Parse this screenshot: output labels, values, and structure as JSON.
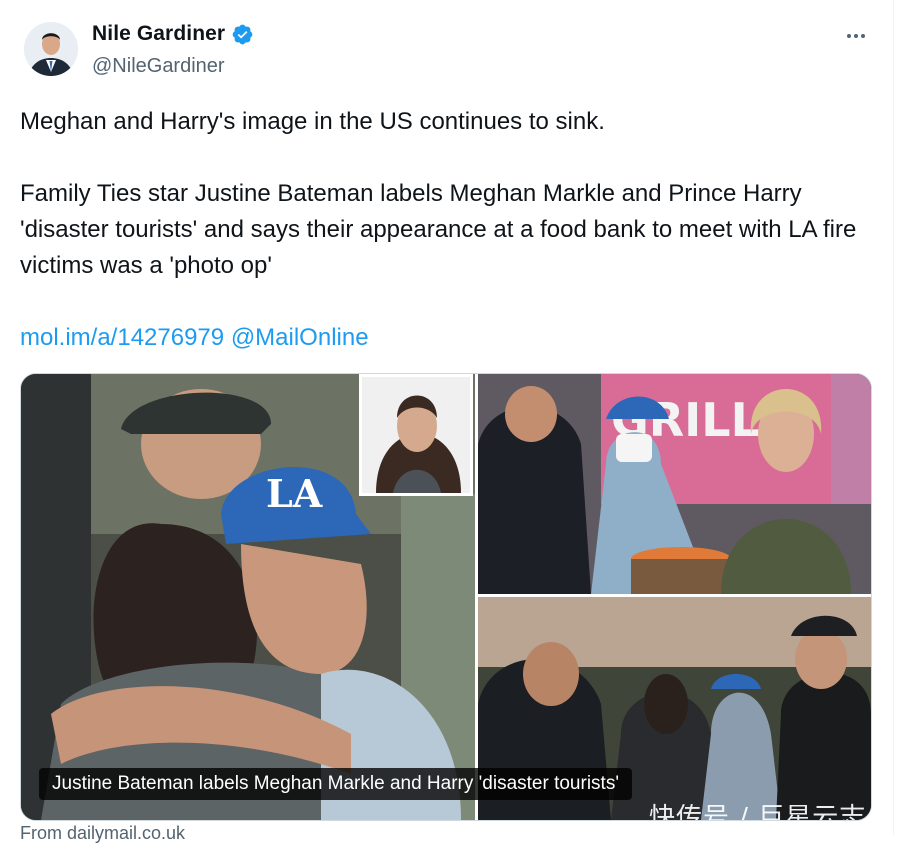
{
  "tweet": {
    "author": {
      "display_name": "Nile Gardiner",
      "handle": "@NileGardiner",
      "verified_icon": "verified-badge-icon"
    },
    "text_paragraph_1": "Meghan and Harry's image in the US continues to sink.",
    "text_paragraph_2": "Family Ties star Justine Bateman labels Meghan Markle and Prince  Harry 'disaster tourists' and says their appearance at a food bank to  meet with LA fire victims was a 'photo op'",
    "link_url": "mol.im/a/14276979",
    "link_mention": "@MailOnline",
    "media": {
      "caption": "Justine Bateman labels Meghan Markle and Harry 'disaster tourists'",
      "watermark": "快传号 / 巨星云志"
    },
    "card_source": "From dailymail.co.uk"
  },
  "colors": {
    "link": "#1d9bf0",
    "secondary_text": "#536471",
    "primary_text": "#0f1419"
  }
}
